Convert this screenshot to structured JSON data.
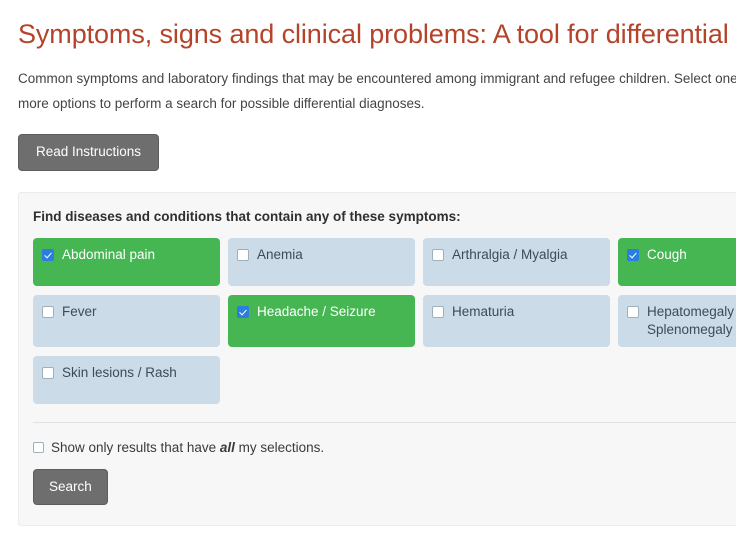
{
  "page": {
    "title": "Symptoms, signs and clinical problems: A tool for differential diagnosis",
    "intro": "Common symptoms and laboratory findings that may be encountered among immigrant and refugee children. Select one or more options to perform a search for possible differential diagnoses.",
    "read_instructions_label": "Read Instructions"
  },
  "search_panel": {
    "heading": "Find diseases and conditions that contain any of these symptoms:",
    "symptoms": [
      {
        "label": "Abdominal pain",
        "selected": true
      },
      {
        "label": "Anemia",
        "selected": false
      },
      {
        "label": "Arthralgia / Myalgia",
        "selected": false
      },
      {
        "label": "Cough",
        "selected": true
      },
      {
        "label": "Fever",
        "selected": false
      },
      {
        "label": "Headache / Seizure",
        "selected": true
      },
      {
        "label": "Hematuria",
        "selected": false
      },
      {
        "label": "Hepatomegaly / Splenomegaly",
        "selected": false
      },
      {
        "label": "Skin lesions / Rash",
        "selected": false
      }
    ],
    "all_option": {
      "text_before": "Show only results that have",
      "emphasis": "all",
      "text_after": "my selections.",
      "checked": false
    },
    "search_label": "Search"
  },
  "colors": {
    "title": "#b5432a",
    "selected_bg": "#46b653",
    "unselected_bg": "#cbdce8",
    "checkbox_on": "#2b7de0",
    "button_bg": "#6e6e6e",
    "panel_bg": "#f7f7f7"
  }
}
